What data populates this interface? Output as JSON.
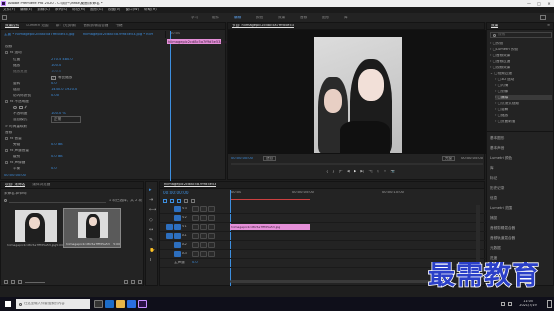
{
  "window": {
    "title": "Adobe Premiere Pro 2020 - C:\\用户\\lhfdz\\桌面\\未命名 *",
    "controls": [
      "—",
      "□",
      "✕"
    ]
  },
  "menu": [
    "文件(F)",
    "编辑(E)",
    "剪辑(C)",
    "序列(S)",
    "标记(M)",
    "图形(G)",
    "视图(V)",
    "窗口(W)",
    "帮助(H)"
  ],
  "workspaces": [
    "学习",
    "组件",
    "编辑",
    "颜色",
    "效果",
    "音频",
    "图形",
    "库"
  ],
  "effect_controls": {
    "tabs": [
      "效果控件",
      "Lumetri 范围",
      "源：(无剪辑)",
      "音频剪辑混合器",
      "书籍"
    ],
    "active_tab": "效果控件",
    "source_label": "主要 * hiimagepic2cd8c5a7fffd5e53.jpg",
    "sequence_label": "hiimagepic2cd8c5a7fffd5e53.jpg * hiimagepic2c…",
    "clip_chip": "hiimagepic2cd8c5a7fffd5e53.jpg",
    "sections": {
      "video": "视频",
      "motion": "fx  运动",
      "opacity": "fx  不透明度",
      "time_remap": "> 时间重映射",
      "audio": "音频",
      "volume": "fx  音量",
      "channel_volume": "fx  声道音量",
      "panner": "fx  声像器"
    },
    "params": [
      {
        "name": "位置",
        "value": "270.5   480.0"
      },
      {
        "name": "缩放",
        "value": "100.0"
      },
      {
        "name": "缩放宽度",
        "value": "100.0"
      },
      {
        "name": "等比缩放",
        "value": "✓"
      },
      {
        "name": "旋转",
        "value": "0.0"
      },
      {
        "name": "锚点",
        "value": "1440.0  1920.0"
      },
      {
        "name": "防闪烁滤镜",
        "value": "0.00"
      },
      {
        "name": "不透明度",
        "value": "100.0 %"
      },
      {
        "name": "混合模式",
        "value": "正常"
      },
      {
        "name": "旁路",
        "value": "0.0 dB"
      },
      {
        "name": "级别",
        "value": "0.0 dB"
      },
      {
        "name": "平衡",
        "value": "0.0"
      }
    ],
    "timecode": "00:00:00:00"
  },
  "program": {
    "tab": "节目: hiimagepic2cd8c5a7fffd5e53",
    "timecode_left": "00:00:00:00",
    "fit": "适合",
    "quality": "完整",
    "timecode_right": "00:00:05:00",
    "controls": [
      "{",
      "}",
      "|←",
      "◀",
      "▶",
      "▶|",
      "→|",
      "⎘",
      "⇪",
      "📷"
    ]
  },
  "project": {
    "tabs": [
      "项目: 未命名",
      "媒体浏览器"
    ],
    "filename": "未命名.prproj",
    "count": "1 项已选择，共 2 项",
    "items": [
      {
        "name": "hiimagepic2cd8c5a7fffd5e53.jpg",
        "duration": "5:00"
      },
      {
        "name": "hiimagepic2cd8c5a7fffd5e53",
        "duration": "5:00"
      }
    ]
  },
  "timeline": {
    "tab": "hiimagepic2cd8c5a7fffd5e53",
    "timecode": "00:00:00:00",
    "ruler": [
      "00:00",
      "00:00:05:00",
      "00:00:10:00"
    ],
    "tracks": [
      "V3",
      "V2",
      "V1",
      "A1",
      "A2",
      "A3",
      "主声道"
    ],
    "master_value": "0.0",
    "clip_label": "hiimagepic2cd8c5a7fffd5e53.jpg"
  },
  "right_panel": {
    "tabs": [
      "效果",
      "≡"
    ],
    "search_placeholder": "搜索",
    "tree": [
      "预设",
      "Lumetri 预设",
      "音频效果",
      "音频过渡",
      "视频效果",
      "视频过渡",
      "3D 运动",
      "内滑",
      "划像",
      "擦除",
      "沉浸式视频",
      "溶解",
      "缩放",
      "页面剥落"
    ],
    "highlighted_tree_index": 9,
    "panels": [
      "基本图形",
      "基本声音",
      "Lumetri 颜色",
      "库",
      "标记",
      "历史记录",
      "信息",
      "Lumetri 范围",
      "捕捉",
      "音频剪辑混合器",
      "音频轨道混合器",
      "元数据",
      "进度"
    ]
  },
  "watermark": "最需教育",
  "taskbar": {
    "search_placeholder": "在这里输入你要搜索的内容",
    "time": "11:05",
    "date": "2021/7/19"
  },
  "colors": {
    "accent": "#2d6fbf",
    "timecode_blue": "#3d8fe0",
    "clip_pink": "#e58fd8",
    "watermark_blue": "#2b40c8"
  }
}
